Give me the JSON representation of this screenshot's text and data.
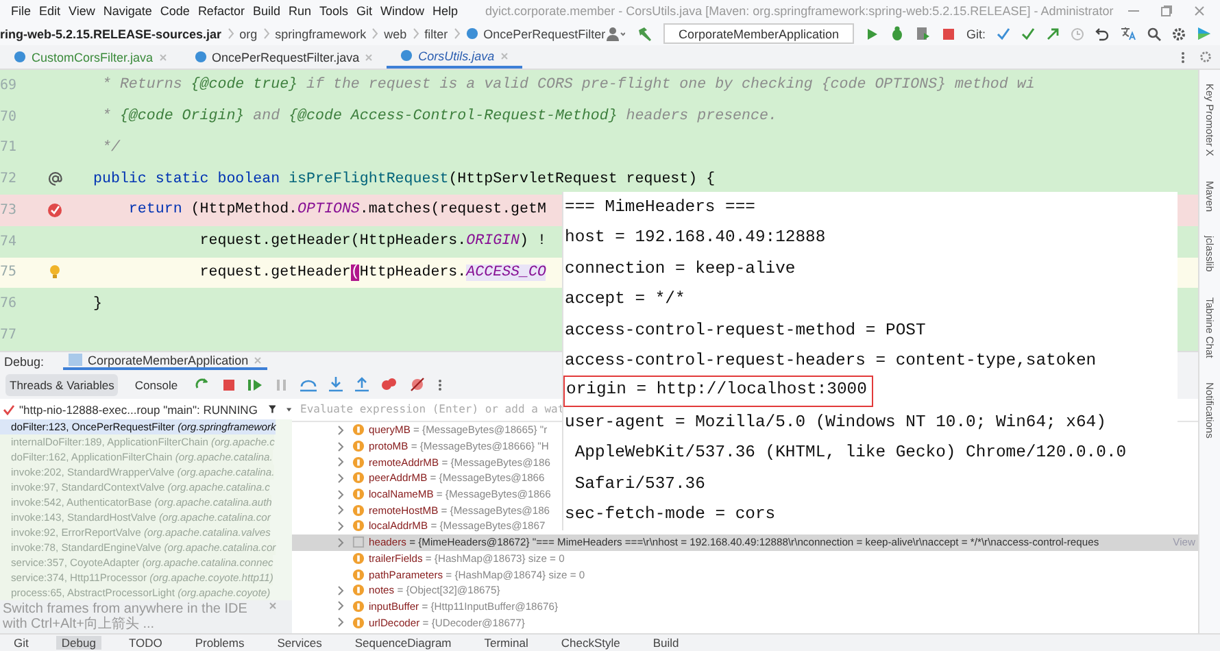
{
  "menu": [
    "File",
    "Edit",
    "View",
    "Navigate",
    "Code",
    "Refactor",
    "Build",
    "Run",
    "Tools",
    "Git",
    "Window",
    "Help"
  ],
  "window": {
    "title": "dyict.corporate.member - CorsUtils.java [Maven: org.springframework:spring-web:5.2.15.RELEASE] - Administrator"
  },
  "breadcrumbs": [
    "ring-web-5.2.15.RELEASE-sources.jar",
    "org",
    "springframework",
    "web",
    "filter",
    "OncePerRequestFilter"
  ],
  "toolbar": {
    "run_configuration": "CorporateMemberApplication",
    "git_label": "Git:"
  },
  "tabs": [
    {
      "label": "CustomCorsFilter.java",
      "selected": false
    },
    {
      "label": "OncePerRequestFilter.java",
      "selected": false
    },
    {
      "label": "CorsUtils.java",
      "selected": true
    }
  ],
  "editor": {
    "lines": [
      {
        "number": "69",
        "kind": "plain",
        "tokens": [
          {
            "kind": "comment",
            "text": " * Returns "
          },
          {
            "kind": "tag",
            "text": "{@code true}"
          },
          {
            "kind": "comment",
            "text": " if the request is a valid CORS pre-flight one by checking {code OPTIONS} method wi"
          }
        ]
      },
      {
        "number": "70",
        "kind": "plain",
        "tokens": [
          {
            "kind": "comment",
            "text": " * "
          },
          {
            "kind": "tag",
            "text": "{@code Origin}"
          },
          {
            "kind": "comment",
            "text": " and "
          },
          {
            "kind": "tag",
            "text": "{@code Access-Control-Request-Method}"
          },
          {
            "kind": "comment",
            "text": " headers presence."
          }
        ]
      },
      {
        "number": "71",
        "kind": "plain",
        "tokens": [
          {
            "kind": "comment",
            "text": " */"
          }
        ]
      },
      {
        "number": "72",
        "kind": "override",
        "tokens": [
          {
            "kind": "keyword",
            "text": "public static boolean "
          },
          {
            "kind": "method",
            "text": "isPreFlightRequest"
          },
          {
            "kind": "plain",
            "text": "(HttpServletRequest request) {"
          }
        ]
      },
      {
        "number": "73",
        "kind": "breakpoint",
        "tokens": [
          {
            "kind": "keyword",
            "text": "    return "
          },
          {
            "kind": "plain",
            "text": "(HttpMethod."
          },
          {
            "kind": "constant",
            "text": "OPTIONS"
          },
          {
            "kind": "plain",
            "text": ".matches(request.getM"
          }
        ]
      },
      {
        "number": "74",
        "kind": "plain",
        "tokens": [
          {
            "kind": "plain",
            "text": "            request.getHeader(HttpHeaders."
          },
          {
            "kind": "constant",
            "text": "ORIGIN"
          },
          {
            "kind": "plain",
            "text": ") !"
          }
        ]
      },
      {
        "number": "75",
        "kind": "bulb",
        "tokens": [
          {
            "kind": "plain",
            "text": "            request.getHeader"
          },
          {
            "kind": "brace",
            "text": "("
          },
          {
            "kind": "plain",
            "text": "HttpHeaders."
          },
          {
            "kind": "constant-selected",
            "text": "ACCESS_CO"
          }
        ]
      },
      {
        "number": "76",
        "kind": "plain",
        "tokens": [
          {
            "kind": "plain",
            "text": "}"
          }
        ]
      },
      {
        "number": "77",
        "kind": "plain"
      }
    ]
  },
  "side_tools": [
    "Key Promoter X",
    "Maven",
    "jclasslib",
    "Tabnine Chat",
    "Notifications"
  ],
  "debug": {
    "label": "Debug:",
    "session_tab": "CorporateMemberApplication",
    "tabs": [
      {
        "label": "Threads & Variables",
        "selected": true
      },
      {
        "label": "Console",
        "selected": false
      }
    ],
    "thread": "\"http-nio-12888-exec...roup \"main\": RUNNING",
    "evaluate_placeholder": "Evaluate expression (Enter) or add a wat",
    "frames": [
      {
        "text": "doFilter:123, OncePerRequestFilter *(org.springframework*",
        "selected": true,
        "library": false
      },
      {
        "text": "internalDoFilter:189, ApplicationFilterChain *(org.apache.c*",
        "selected": false,
        "library": true
      },
      {
        "text": "doFilter:162, ApplicationFilterChain *(org.apache.catalina.*",
        "selected": false,
        "library": true
      },
      {
        "text": "invoke:202, StandardWrapperValve *(org.apache.catalina.*",
        "selected": false,
        "library": true
      },
      {
        "text": "invoke:97, StandardContextValve *(org.apache.catalina.c*",
        "selected": false,
        "library": true
      },
      {
        "text": "invoke:542, AuthenticatorBase *(org.apache.catalina.auth*",
        "selected": false,
        "library": true
      },
      {
        "text": "invoke:143, StandardHostValve *(org.apache.catalina.cor*",
        "selected": false,
        "library": true
      },
      {
        "text": "invoke:92, ErrorReportValve *(org.apache.catalina.valves*",
        "selected": false,
        "library": true
      },
      {
        "text": "invoke:78, StandardEngineValve *(org.apache.catalina.cor*",
        "selected": false,
        "library": true
      },
      {
        "text": "service:357, CoyoteAdapter *(org.apache.catalina.connec*",
        "selected": false,
        "library": true
      },
      {
        "text": "service:374, Http11Processor *(org.apache.coyote.http11)*",
        "selected": false,
        "library": true
      },
      {
        "text": "process:65, AbstractProcessorLight *(org.apache.coyote)*",
        "selected": false,
        "library": true
      }
    ],
    "hint": "Switch frames from anywhere in the IDE with Ctrl+Alt+向上箭头 ...",
    "variables": [
      {
        "name": "queryMB",
        "value": "= {MessageBytes@18665} \"r",
        "expandable": true,
        "selected": false
      },
      {
        "name": "protoMB",
        "value": "= {MessageBytes@18666} \"H",
        "expandable": true,
        "selected": false
      },
      {
        "name": "remoteAddrMB",
        "value": "= {MessageBytes@186",
        "expandable": true,
        "selected": false
      },
      {
        "name": "peerAddrMB",
        "value": "= {MessageBytes@1866",
        "expandable": true,
        "selected": false
      },
      {
        "name": "localNameMB",
        "value": "= {MessageBytes@1866",
        "expandable": true,
        "selected": false
      },
      {
        "name": "remoteHostMB",
        "value": "= {MessageBytes@186",
        "expandable": true,
        "selected": false
      },
      {
        "name": "localAddrMB",
        "value": "= {MessageBytes@1867",
        "expandable": true,
        "selected": false
      },
      {
        "name": "headers",
        "value": "= {MimeHeaders@18672} \"=== MimeHeaders ===\\r\\nhost = 192.168.40.49:12888\\r\\nconnection = keep-alive\\r\\naccept = */*\\r\\naccess-control-reques",
        "link": "View",
        "expandable": true,
        "selected": true
      },
      {
        "name": "trailerFields",
        "value": "= {HashMap@18673}  size = 0",
        "expandable": false,
        "selected": false
      },
      {
        "name": "pathParameters",
        "value": "= {HashMap@18674}  size = 0",
        "expandable": false,
        "selected": false
      },
      {
        "name": "notes",
        "value": "= {Object[32]@18675}",
        "expandable": true,
        "selected": false
      },
      {
        "name": "inputBuffer",
        "value": "= {Http11InputBuffer@18676}",
        "expandable": true,
        "selected": false
      },
      {
        "name": "urlDecoder",
        "value": "= {UDecoder@18677}",
        "expandable": true,
        "selected": false
      }
    ]
  },
  "popup": {
    "lines": [
      {
        "text": "=== MimeHeaders ===",
        "highlighted": false
      },
      {
        "text": "host = 192.168.40.49:12888",
        "highlighted": false
      },
      {
        "text": "connection = keep-alive",
        "highlighted": false
      },
      {
        "text": "accept = */*",
        "highlighted": false
      },
      {
        "text": "access-control-request-method = POST",
        "highlighted": false
      },
      {
        "text": "access-control-request-headers = content-type,satoken",
        "highlighted": false
      },
      {
        "text": "origin = http://localhost:3000",
        "highlighted": true
      },
      {
        "text": "user-agent = Mozilla/5.0 (Windows NT 10.0; Win64; x64)",
        "highlighted": false
      },
      {
        "text": " AppleWebKit/537.36 (KHTML, like Gecko) Chrome/120.0.0.0",
        "highlighted": false
      },
      {
        "text": " Safari/537.36",
        "highlighted": false
      },
      {
        "text": "sec-fetch-mode = cors",
        "highlighted": false
      }
    ]
  },
  "bottom_tools": [
    {
      "label": "Git",
      "selected": false
    },
    {
      "label": "Debug",
      "selected": true
    },
    {
      "label": "TODO",
      "selected": false
    },
    {
      "label": "Problems",
      "selected": false
    },
    {
      "label": "Services",
      "selected": false
    },
    {
      "label": "SequenceDiagram",
      "selected": false
    },
    {
      "label": "Terminal",
      "selected": false
    },
    {
      "label": "CheckStyle",
      "selected": false
    },
    {
      "label": "Build",
      "selected": false
    }
  ]
}
